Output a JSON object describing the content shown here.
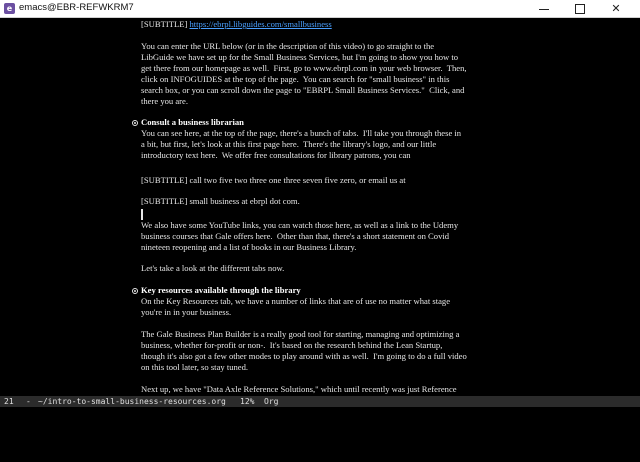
{
  "window": {
    "title": "emacs@EBR-REFWKRM7",
    "app_icon_name": "emacs-icon"
  },
  "content": {
    "p1": [
      "[SUBTITLE] "
    ],
    "p1_link": "https://ebrpl.libguides.com/smallbusiness",
    "p2": [
      "You can enter the URL below (or in the description of this video) to go straight to the",
      "LibGuide we have set up for the Small Business Services, but I'm going to show you how to",
      "get there from our homepage as well.  First, go to www.ebrpl.com in your web browser.  Then,",
      "click on INFOGUIDES at the top of the page.  You can search for \"small business\" in this",
      "search box, or you can scroll down the page to \"EBRPL Small Business Services.\"  Click, and",
      "there you are."
    ],
    "h1": "Consult a business librarian",
    "p3": [
      "You can see here, at the top of the page, there's a bunch of tabs.  I'll take you through these in",
      "a bit, but first, let's look at this first page here.  There's the library's logo, and our little",
      "introductory text here.  We offer free consultations for library patrons, you can"
    ],
    "p4": "[SUBTITLE] call two five two three one three seven five zero, or email us at",
    "p5": "[SUBTITLE] small business at ebrpl dot com.",
    "p6": [
      "We also have some YouTube links, you can watch those here, as well as a link to the Udemy",
      "business courses that Gale offers here.  Other than that, there's a short statement on Covid",
      "nineteen reopening and a list of books in our Business Library."
    ],
    "p7": "Let's take a look at the different tabs now.",
    "h2": "Key resources available through the library",
    "p8": [
      "On the Key Resources tab, we have a number of links that are of use no matter what stage",
      "you're in in your business."
    ],
    "p9": [
      "The Gale Business Plan Builder is a really good tool for starting, managing and optimizing a",
      "business, whether for-profit or non-.  It's based on the research behind the Lean Startup,",
      "though it's also got a few other modes to play around with as well.  I'm going to do a full video",
      "on this tool later, so stay tuned."
    ],
    "p10": "Next up, we have \"Data Axle Reference Solutions,\" which until recently was just Reference"
  },
  "modeline": {
    "line": "21",
    "separator": "-",
    "file": "~/intro-to-small-business-resources.org",
    "percent": "12%",
    "mode": "Org"
  }
}
